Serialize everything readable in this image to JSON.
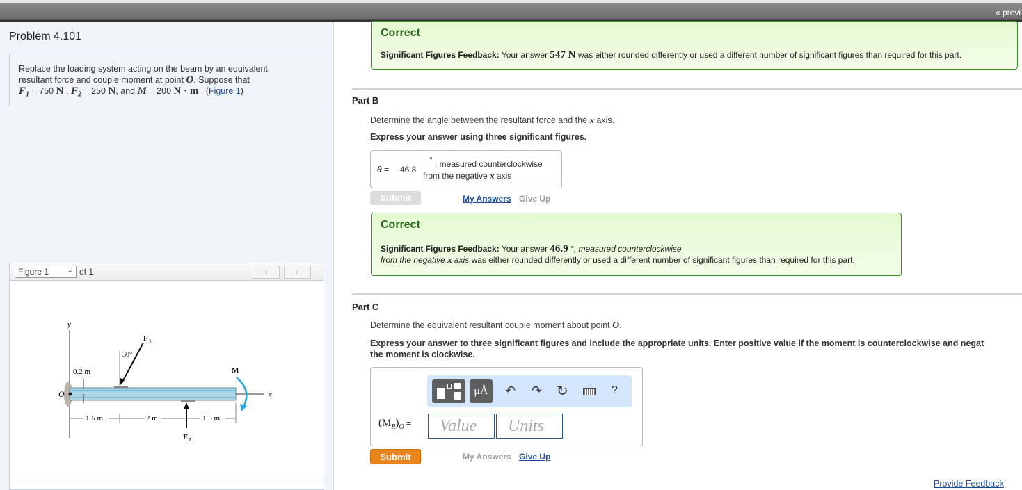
{
  "topbar": {
    "prev_label": "« previ"
  },
  "problem": {
    "title": "Problem 4.101",
    "text1": "Replace the loading system acting on the beam by an equivalent",
    "text2": "resultant force and couple moment at point ",
    "point": "O",
    "text3": ". Suppose that",
    "f1_sym": "F",
    "f1_sub": "1",
    "f1_val": " = 750 ",
    "f1_unit": "N",
    "f2_sym": "F",
    "f2_sub": "2",
    "f2_val": " = 250 ",
    "f2_unit": "N",
    "and": ", and ",
    "m_sym": "M",
    "m_val": " = 200 ",
    "m_unit": "N · m",
    "figure_link": "Figure 1"
  },
  "figure": {
    "selected": "Figure 1",
    "of_label": "of 1",
    "labels": {
      "y": "y",
      "x": "x",
      "O": "O",
      "F1": "F",
      "F1_sub": "1",
      "F2": "F",
      "F2_sub": "2",
      "M": "M",
      "angle": "30°",
      "h": "0.2 m",
      "d1": "1.5 m",
      "d2": "2 m",
      "d3": "1.5 m"
    },
    "moment_color": "#29a3dc"
  },
  "partA_feedback": {
    "status": "Correct",
    "label": "Significant Figures Feedback:",
    "text_pre": " Your answer ",
    "answer": "547 N",
    "text_post": " was either rounded differently or used a different number of significant figures than required for this part."
  },
  "partB": {
    "title": "Part B",
    "question_pre": "Determine the angle between the resultant force and the ",
    "question_var": "x",
    "question_post": " axis.",
    "instruction": "Express your answer using three significant figures.",
    "theta_label": "θ",
    "equals": " = ",
    "value": "46.8",
    "degree": "°",
    "unit_line1": ", measured counterclockwise",
    "unit_line2_pre": "from the negative ",
    "unit_line2_post": " axis",
    "submit": "Submit",
    "my_answers": "My Answers",
    "give_up": "Give Up",
    "feedback": {
      "status": "Correct",
      "label": "Significant Figures Feedback:",
      "text_pre": " Your answer ",
      "answer": "46.9",
      "text_mid": " °, measured counterclockwise",
      "line2_pre": "from the negative ",
      "line2_italic_end": " axis",
      "line2_post": " was either rounded differently or used a different number of significant figures than required for this part."
    }
  },
  "partC": {
    "title": "Part C",
    "question_pre": "Determine the equivalent resultant couple moment about point ",
    "question_var": "O",
    "question_post": ".",
    "instruction1": "Express your answer to three significant figures and include the appropriate units. Enter positive value if the moment is counterclockwise and negat",
    "instruction2": "the moment is clockwise.",
    "label": "(M",
    "label_sub": "R",
    "label_end": ")",
    "label_sub2": "O",
    "equals": " =",
    "value_placeholder": "Value",
    "units_placeholder": "Units",
    "toolbar": {
      "units_btn": "μÅ",
      "help": "?"
    },
    "submit": "Submit",
    "my_answers": "My Answers",
    "give_up": "Give Up"
  },
  "footer": {
    "provide_feedback": "Provide Feedback"
  },
  "colors": {
    "correct_border": "#3d8f2c",
    "correct_bg": "#e8fad8",
    "submit_orange": "#e8861d",
    "link": "#1f4e9c"
  }
}
